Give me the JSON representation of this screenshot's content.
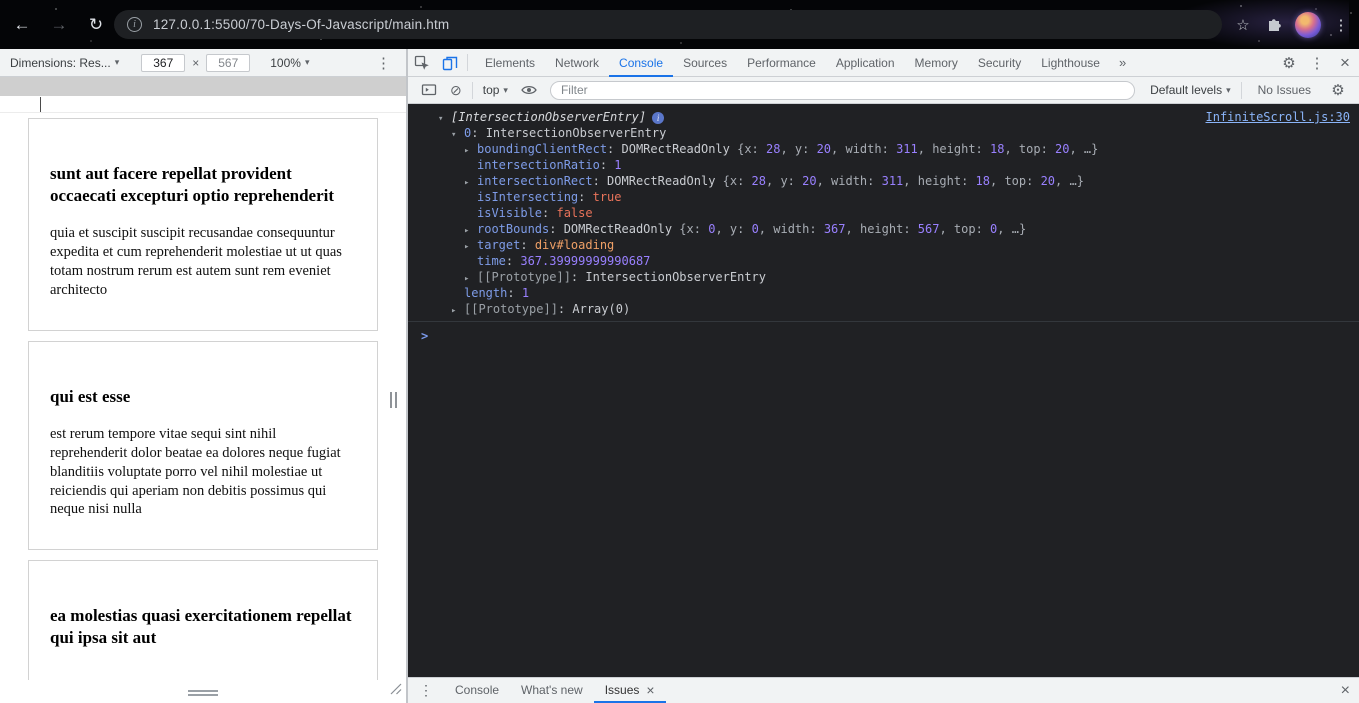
{
  "browser": {
    "url": "127.0.0.1:5500/70-Days-Of-Javascript/main.htm"
  },
  "device_toolbar": {
    "dimensions_label": "Dimensions: Res...",
    "width": "367",
    "times": "×",
    "height": "567",
    "zoom": "100%"
  },
  "devtools": {
    "tabs": [
      "Elements",
      "Network",
      "Console",
      "Sources",
      "Performance",
      "Application",
      "Memory",
      "Security",
      "Lighthouse"
    ],
    "selected_tab": "Console",
    "more_tabs_glyph": "»",
    "console_toolbar": {
      "context_selector": "top",
      "filter_placeholder": "Filter",
      "levels_label": "Default levels",
      "issues_label": "No Issues"
    },
    "drawer": {
      "tabs": [
        {
          "label": "Console",
          "selected": false,
          "closable": false
        },
        {
          "label": "What's new",
          "selected": false,
          "closable": false
        },
        {
          "label": "Issues",
          "selected": true,
          "closable": true
        }
      ]
    }
  },
  "console": {
    "source_link": "InfiniteScroll.js:30",
    "prompt": ">",
    "lines": [
      {
        "indent": 0,
        "toggle": "open",
        "info": true,
        "link": true,
        "segments": [
          {
            "c": "arr",
            "t": "[IntersectionObserverEntry]"
          }
        ]
      },
      {
        "indent": 1,
        "toggle": "open",
        "segments": [
          {
            "c": "key",
            "t": "0"
          },
          {
            "c": "plain",
            "t": ": "
          },
          {
            "c": "obj",
            "t": "IntersectionObserverEntry"
          }
        ]
      },
      {
        "indent": 2,
        "toggle": "closed",
        "segments": [
          {
            "c": "key",
            "t": "boundingClientRect"
          },
          {
            "c": "plain",
            "t": ": "
          },
          {
            "c": "obj",
            "t": "DOMRectReadOnly "
          },
          {
            "c": "prev",
            "t": "{x: "
          },
          {
            "c": "num",
            "t": "28"
          },
          {
            "c": "prev",
            "t": ", y: "
          },
          {
            "c": "num",
            "t": "20"
          },
          {
            "c": "prev",
            "t": ", width: "
          },
          {
            "c": "num",
            "t": "311"
          },
          {
            "c": "prev",
            "t": ", height: "
          },
          {
            "c": "num",
            "t": "18"
          },
          {
            "c": "prev",
            "t": ", top: "
          },
          {
            "c": "num",
            "t": "20"
          },
          {
            "c": "prev",
            "t": ", …}"
          }
        ]
      },
      {
        "indent": 2,
        "toggle": "none",
        "segments": [
          {
            "c": "key",
            "t": "intersectionRatio"
          },
          {
            "c": "plain",
            "t": ": "
          },
          {
            "c": "num",
            "t": "1"
          }
        ]
      },
      {
        "indent": 2,
        "toggle": "closed",
        "segments": [
          {
            "c": "key",
            "t": "intersectionRect"
          },
          {
            "c": "plain",
            "t": ": "
          },
          {
            "c": "obj",
            "t": "DOMRectReadOnly "
          },
          {
            "c": "prev",
            "t": "{x: "
          },
          {
            "c": "num",
            "t": "28"
          },
          {
            "c": "prev",
            "t": ", y: "
          },
          {
            "c": "num",
            "t": "20"
          },
          {
            "c": "prev",
            "t": ", width: "
          },
          {
            "c": "num",
            "t": "311"
          },
          {
            "c": "prev",
            "t": ", height: "
          },
          {
            "c": "num",
            "t": "18"
          },
          {
            "c": "prev",
            "t": ", top: "
          },
          {
            "c": "num",
            "t": "20"
          },
          {
            "c": "prev",
            "t": ", …}"
          }
        ]
      },
      {
        "indent": 2,
        "toggle": "none",
        "segments": [
          {
            "c": "key",
            "t": "isIntersecting"
          },
          {
            "c": "plain",
            "t": ": "
          },
          {
            "c": "bool",
            "t": "true"
          }
        ]
      },
      {
        "indent": 2,
        "toggle": "none",
        "segments": [
          {
            "c": "key",
            "t": "isVisible"
          },
          {
            "c": "plain",
            "t": ": "
          },
          {
            "c": "bool",
            "t": "false"
          }
        ]
      },
      {
        "indent": 2,
        "toggle": "closed",
        "segments": [
          {
            "c": "key",
            "t": "rootBounds"
          },
          {
            "c": "plain",
            "t": ": "
          },
          {
            "c": "obj",
            "t": "DOMRectReadOnly "
          },
          {
            "c": "prev",
            "t": "{x: "
          },
          {
            "c": "num",
            "t": "0"
          },
          {
            "c": "prev",
            "t": ", y: "
          },
          {
            "c": "num",
            "t": "0"
          },
          {
            "c": "prev",
            "t": ", width: "
          },
          {
            "c": "num",
            "t": "367"
          },
          {
            "c": "prev",
            "t": ", height: "
          },
          {
            "c": "num",
            "t": "567"
          },
          {
            "c": "prev",
            "t": ", top: "
          },
          {
            "c": "num",
            "t": "0"
          },
          {
            "c": "prev",
            "t": ", …}"
          }
        ]
      },
      {
        "indent": 2,
        "toggle": "closed",
        "segments": [
          {
            "c": "key",
            "t": "target"
          },
          {
            "c": "plain",
            "t": ": "
          },
          {
            "c": "node",
            "t": "div#loading"
          }
        ]
      },
      {
        "indent": 2,
        "toggle": "none",
        "segments": [
          {
            "c": "key",
            "t": "time"
          },
          {
            "c": "plain",
            "t": ": "
          },
          {
            "c": "num",
            "t": "367.39999999990687"
          }
        ]
      },
      {
        "indent": 2,
        "toggle": "closed",
        "segments": [
          {
            "c": "proto",
            "t": "[[Prototype]]"
          },
          {
            "c": "plain",
            "t": ": "
          },
          {
            "c": "obj",
            "t": "IntersectionObserverEntry"
          }
        ]
      },
      {
        "indent": 1,
        "toggle": "none",
        "segments": [
          {
            "c": "key",
            "t": "length"
          },
          {
            "c": "plain",
            "t": ": "
          },
          {
            "c": "num",
            "t": "1"
          }
        ]
      },
      {
        "indent": 1,
        "toggle": "closed",
        "segments": [
          {
            "c": "proto",
            "t": "[[Prototype]]"
          },
          {
            "c": "plain",
            "t": ": "
          },
          {
            "c": "obj",
            "t": "Array(0)"
          }
        ]
      }
    ]
  },
  "page": {
    "posts": [
      {
        "title": "sunt aut facere repellat provident occaecati excepturi optio reprehenderit",
        "body": "quia et suscipit suscipit recusandae consequuntur expedita et cum reprehenderit molestiae ut ut quas totam nostrum rerum est autem sunt rem eveniet architecto"
      },
      {
        "title": "qui est esse",
        "body": "est rerum tempore vitae sequi sint nihil reprehenderit dolor beatae ea dolores neque fugiat blanditiis voluptate porro vel nihil molestiae ut reiciendis qui aperiam non debitis possimus qui neque nisi nulla"
      },
      {
        "title": "ea molestias quasi exercitationem repellat qui ipsa sit aut",
        "body": ""
      }
    ]
  }
}
